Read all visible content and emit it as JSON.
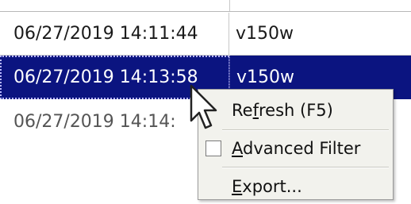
{
  "table": {
    "rows": [
      {
        "date": "06/27/2019 14:11:44",
        "version": "v150w",
        "selected": false
      },
      {
        "date": "06/27/2019 14:13:58",
        "version": "v150w",
        "selected": true
      },
      {
        "date": "06/27/2019 14:14:",
        "version": "",
        "selected": false
      }
    ]
  },
  "context_menu": {
    "items": [
      {
        "prefix": "Re",
        "mnemonic": "f",
        "suffix": "resh (F5)",
        "has_checkbox": false,
        "checked": false
      },
      {
        "prefix": "",
        "mnemonic": "A",
        "suffix": "dvanced Filter",
        "has_checkbox": true,
        "checked": false
      },
      {
        "prefix": "",
        "mnemonic": "E",
        "suffix": "xport...",
        "has_checkbox": false,
        "checked": false
      }
    ]
  },
  "colors": {
    "selection_bg": "#0b1480",
    "selection_text": "#ffffff",
    "menu_bg": "#f2f2ed"
  },
  "icons": {
    "cursor": "arrow-pointer-icon",
    "advanced_filter_check": "checkbox-icon"
  }
}
